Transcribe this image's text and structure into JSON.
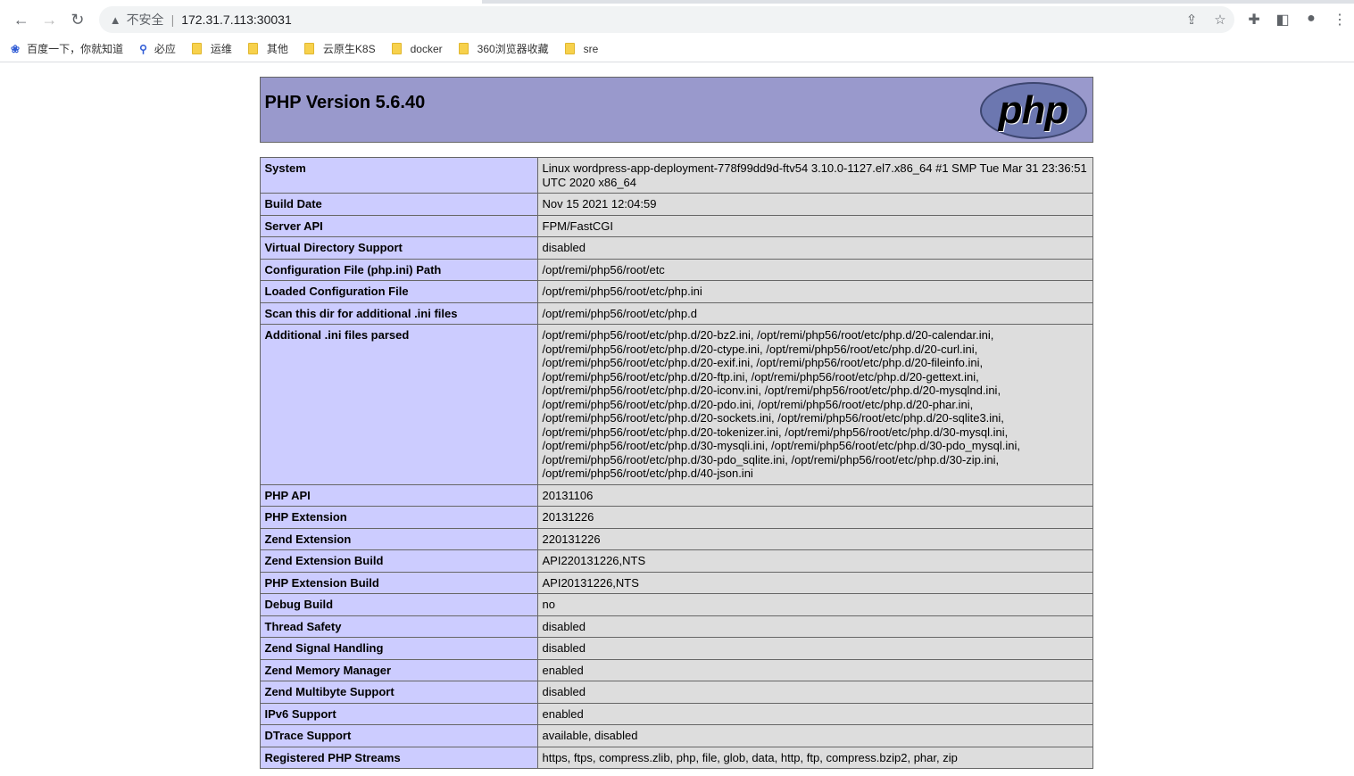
{
  "browser": {
    "security_label": "不安全",
    "url": "172.31.7.113:30031",
    "bookmarks": [
      {
        "label": "百度一下，你就知道",
        "icon": "baidu-paw-icon"
      },
      {
        "label": "必应",
        "icon": "search-icon"
      },
      {
        "label": "运维",
        "icon": "folder-icon"
      },
      {
        "label": "其他",
        "icon": "folder-icon"
      },
      {
        "label": "云原生K8S",
        "icon": "folder-icon"
      },
      {
        "label": "docker",
        "icon": "folder-icon"
      },
      {
        "label": "360浏览器收藏",
        "icon": "folder-icon"
      },
      {
        "label": "sre",
        "icon": "folder-icon"
      }
    ]
  },
  "page": {
    "title": "PHP Version 5.6.40",
    "logo_text": "php",
    "rows": [
      {
        "k": "System",
        "v": "Linux wordpress-app-deployment-778f99dd9d-ftv54 3.10.0-1127.el7.x86_64 #1 SMP Tue Mar 31 23:36:51 UTC 2020 x86_64"
      },
      {
        "k": "Build Date",
        "v": "Nov 15 2021 12:04:59"
      },
      {
        "k": "Server API",
        "v": "FPM/FastCGI"
      },
      {
        "k": "Virtual Directory Support",
        "v": "disabled"
      },
      {
        "k": "Configuration File (php.ini) Path",
        "v": "/opt/remi/php56/root/etc"
      },
      {
        "k": "Loaded Configuration File",
        "v": "/opt/remi/php56/root/etc/php.ini"
      },
      {
        "k": "Scan this dir for additional .ini files",
        "v": "/opt/remi/php56/root/etc/php.d"
      },
      {
        "k": "Additional .ini files parsed",
        "v": "/opt/remi/php56/root/etc/php.d/20-bz2.ini, /opt/remi/php56/root/etc/php.d/20-calendar.ini, /opt/remi/php56/root/etc/php.d/20-ctype.ini, /opt/remi/php56/root/etc/php.d/20-curl.ini, /opt/remi/php56/root/etc/php.d/20-exif.ini, /opt/remi/php56/root/etc/php.d/20-fileinfo.ini, /opt/remi/php56/root/etc/php.d/20-ftp.ini, /opt/remi/php56/root/etc/php.d/20-gettext.ini, /opt/remi/php56/root/etc/php.d/20-iconv.ini, /opt/remi/php56/root/etc/php.d/20-mysqlnd.ini, /opt/remi/php56/root/etc/php.d/20-pdo.ini, /opt/remi/php56/root/etc/php.d/20-phar.ini, /opt/remi/php56/root/etc/php.d/20-sockets.ini, /opt/remi/php56/root/etc/php.d/20-sqlite3.ini, /opt/remi/php56/root/etc/php.d/20-tokenizer.ini, /opt/remi/php56/root/etc/php.d/30-mysql.ini, /opt/remi/php56/root/etc/php.d/30-mysqli.ini, /opt/remi/php56/root/etc/php.d/30-pdo_mysql.ini, /opt/remi/php56/root/etc/php.d/30-pdo_sqlite.ini, /opt/remi/php56/root/etc/php.d/30-zip.ini, /opt/remi/php56/root/etc/php.d/40-json.ini"
      },
      {
        "k": "PHP API",
        "v": "20131106"
      },
      {
        "k": "PHP Extension",
        "v": "20131226"
      },
      {
        "k": "Zend Extension",
        "v": "220131226"
      },
      {
        "k": "Zend Extension Build",
        "v": "API220131226,NTS"
      },
      {
        "k": "PHP Extension Build",
        "v": "API20131226,NTS"
      },
      {
        "k": "Debug Build",
        "v": "no"
      },
      {
        "k": "Thread Safety",
        "v": "disabled"
      },
      {
        "k": "Zend Signal Handling",
        "v": "disabled"
      },
      {
        "k": "Zend Memory Manager",
        "v": "enabled"
      },
      {
        "k": "Zend Multibyte Support",
        "v": "disabled"
      },
      {
        "k": "IPv6 Support",
        "v": "enabled"
      },
      {
        "k": "DTrace Support",
        "v": "available, disabled"
      },
      {
        "k": "Registered PHP Streams",
        "v": "https, ftps, compress.zlib, php, file, glob, data, http, ftp, compress.bzip2, phar, zip"
      }
    ]
  }
}
